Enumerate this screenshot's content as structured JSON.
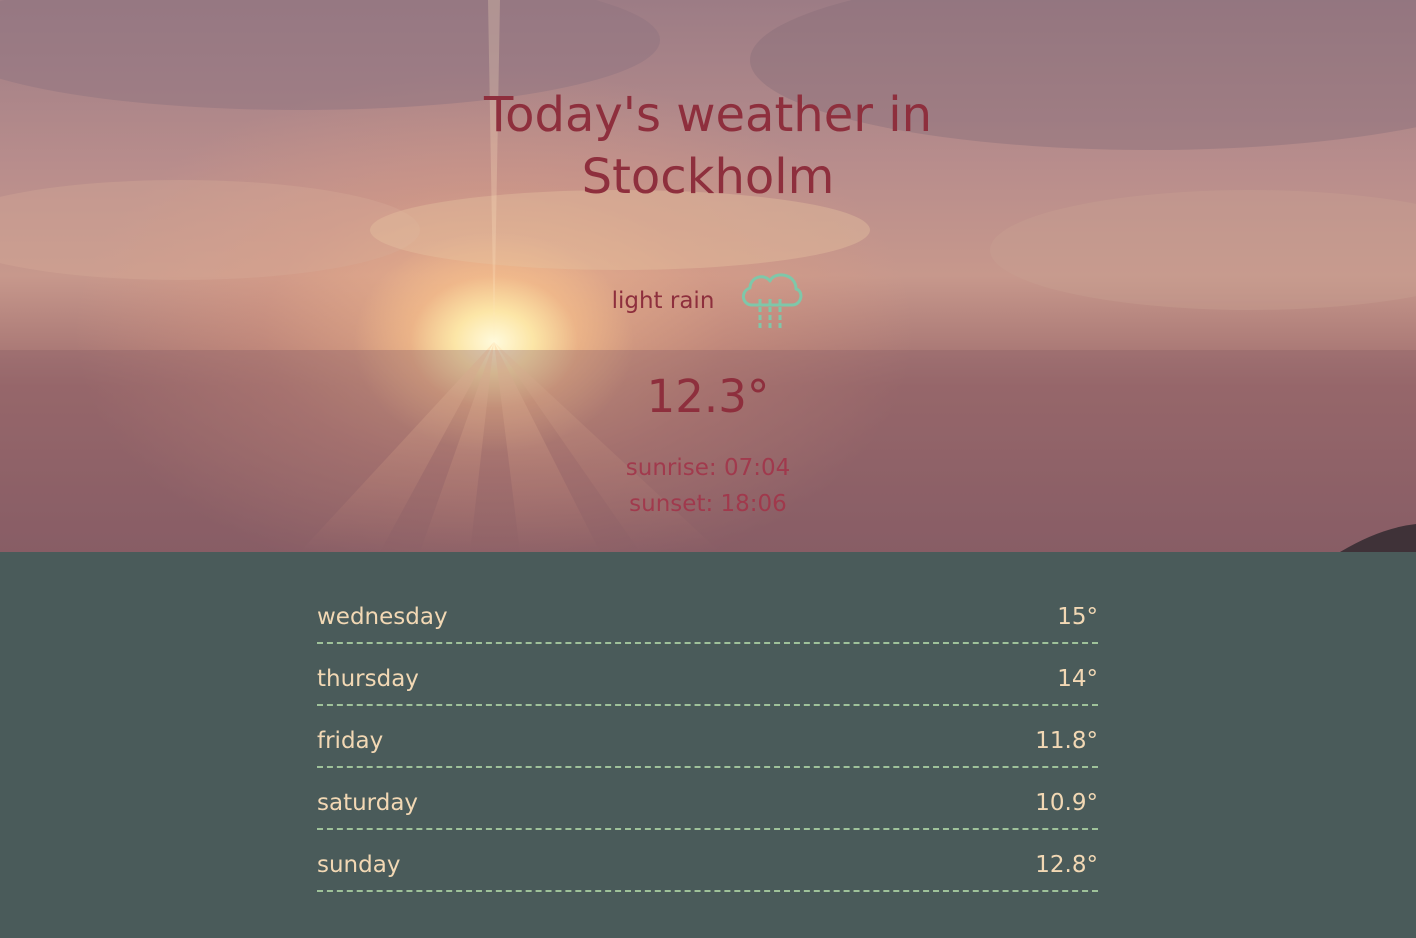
{
  "header": {
    "title": "Today's weather in Stockholm"
  },
  "current": {
    "condition": "light rain",
    "condition_icon": "cloud-rain-icon",
    "temperature": "12.3°",
    "sunrise": "sunrise: 07:04",
    "sunset": "sunset: 18:06"
  },
  "forecast": [
    {
      "day": "wednesday",
      "temp": "15°"
    },
    {
      "day": "thursday",
      "temp": "14°"
    },
    {
      "day": "friday",
      "temp": "11.8°"
    },
    {
      "day": "saturday",
      "temp": "10.9°"
    },
    {
      "day": "sunday",
      "temp": "12.8°"
    }
  ],
  "colors": {
    "title_text": "#8e2f3d",
    "icon": "#7fc7a9",
    "forecast_bg": "#4a5b5a",
    "forecast_text": "#f2d8b4",
    "divider": "#9fc29a"
  }
}
